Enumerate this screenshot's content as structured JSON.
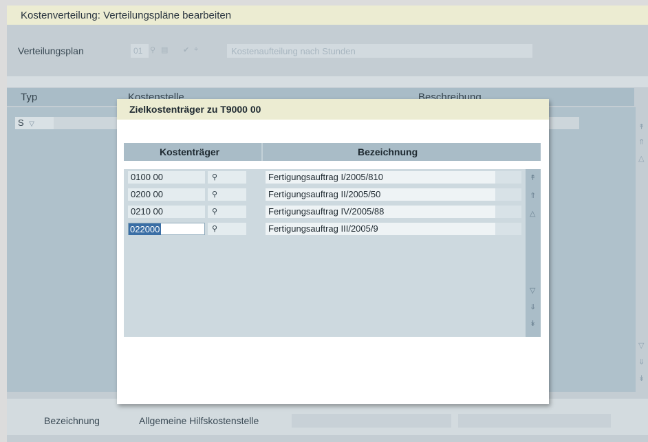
{
  "window": {
    "title": "Kostenverteilung: Verteilungspläne bearbeiten"
  },
  "plan": {
    "label": "Verteilungsplan",
    "code": "01",
    "description": "Kostenaufteilung nach Stunden"
  },
  "main_table": {
    "columns": [
      "Typ",
      "Kostenstelle",
      "Beschreibung"
    ],
    "first_row_type": "S"
  },
  "bottom": {
    "label": "Bezeichnung",
    "value": "Allgemeine Hilfskostenstelle"
  },
  "dialog": {
    "title": "Zielkostenträger zu T9000  00",
    "columns": [
      "Kostenträger",
      "Bezeichnung"
    ],
    "rows": [
      {
        "code": "0100  00",
        "desc": "Fertigungsauftrag I/2005/810"
      },
      {
        "code": "0200  00",
        "desc": "Fertigungsauftrag II/2005/50"
      },
      {
        "code": "0210  00",
        "desc": "Fertigungsauftrag IV/2005/88"
      },
      {
        "code": "022000",
        "desc": "Fertigungsauftrag III/2005/9"
      }
    ]
  },
  "icons": {
    "search": "magnifier-icon",
    "scroll_top": "double-arrow-up-icon",
    "scroll_page_up": "page-up-icon",
    "scroll_up": "arrow-up-icon",
    "scroll_down": "arrow-down-icon",
    "scroll_page_down": "page-down-icon",
    "scroll_bottom": "double-arrow-down-icon"
  },
  "colors": {
    "title_bar": "#ececd2",
    "header": "#a9bcc7",
    "selection": "#3a6ea5"
  }
}
